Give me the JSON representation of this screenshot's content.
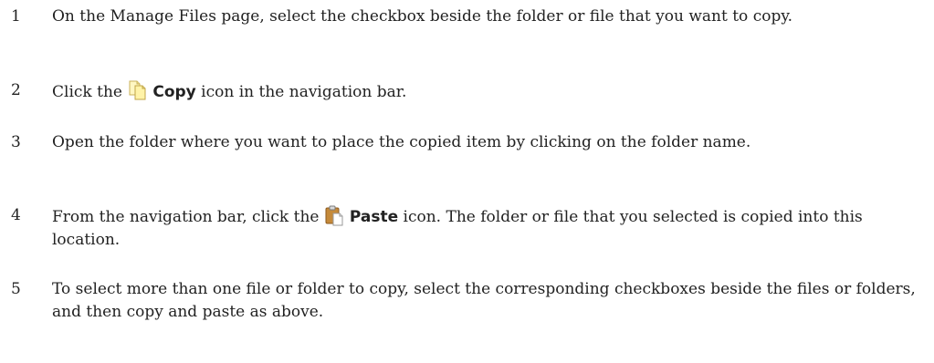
{
  "steps": [
    {
      "number": "1",
      "text": "On the Manage Files page, select the checkbox beside the folder or file that you want to copy."
    },
    {
      "number": "2",
      "before": "Click the ",
      "bold": "Copy",
      "after": " icon in the navigation bar.",
      "icon": "copy-icon"
    },
    {
      "number": "3",
      "text": "Open the folder where you want to place the copied item by clicking on the folder name."
    },
    {
      "number": "4",
      "before": "From the navigation bar, click the ",
      "bold": "Paste",
      "after": " icon. The folder or file that you selected is copied into this location.",
      "icon": "paste-icon"
    },
    {
      "number": "5",
      "text": "To select more than one file or folder to copy, select the corresponding checkboxes beside the files or folders, and then copy and paste as above."
    }
  ]
}
